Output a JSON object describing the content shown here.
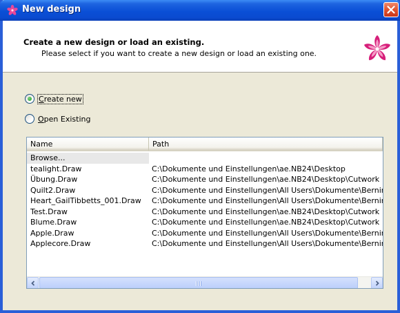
{
  "window": {
    "title": "New design"
  },
  "header": {
    "title": "Create a new design or load an existing.",
    "subtitle": "Please select if you want to create a new design or load an existing one."
  },
  "options": {
    "create_new": {
      "label_underlined": "C",
      "label_rest": "reate new",
      "selected": true
    },
    "open_existing": {
      "label_underlined": "O",
      "label_rest": "pen Existing",
      "selected": false
    }
  },
  "list": {
    "columns": [
      "Name",
      "Path"
    ],
    "rows": [
      {
        "name": "Browse...",
        "path": ""
      },
      {
        "name": "tealight.Draw",
        "path": "C:\\Dokumente und Einstellungen\\ae.NB24\\Desktop"
      },
      {
        "name": "Übung.Draw",
        "path": "C:\\Dokumente und Einstellungen\\ae.NB24\\Desktop\\Cutwork"
      },
      {
        "name": "Quilt2.Draw",
        "path": "C:\\Dokumente und Einstellungen\\All Users\\Dokumente\\Bernir"
      },
      {
        "name": "Heart_GailTibbetts_001.Draw",
        "path": "C:\\Dokumente und Einstellungen\\All Users\\Dokumente\\Bernir"
      },
      {
        "name": "Test.Draw",
        "path": "C:\\Dokumente und Einstellungen\\ae.NB24\\Desktop\\Cutwork"
      },
      {
        "name": "Blume.Draw",
        "path": "C:\\Dokumente und Einstellungen\\ae.NB24\\Desktop\\Cutwork"
      },
      {
        "name": "Apple.Draw",
        "path": "C:\\Dokumente und Einstellungen\\All Users\\Dokumente\\Bernir"
      },
      {
        "name": "Applecore.Draw",
        "path": "C:\\Dokumente und Einstellungen\\All Users\\Dokumente\\Bernir"
      }
    ]
  },
  "icons": {
    "app": "flower-icon",
    "close": "close-icon",
    "logo": "flower-logo-icon",
    "scroll_left": "scroll-left-icon",
    "scroll_right": "scroll-right-icon"
  },
  "colors": {
    "titlebar": "#0a4fd6",
    "close_button": "#e0532f",
    "flower": "#d61f7a",
    "dialog_bg": "#ece9d8"
  }
}
